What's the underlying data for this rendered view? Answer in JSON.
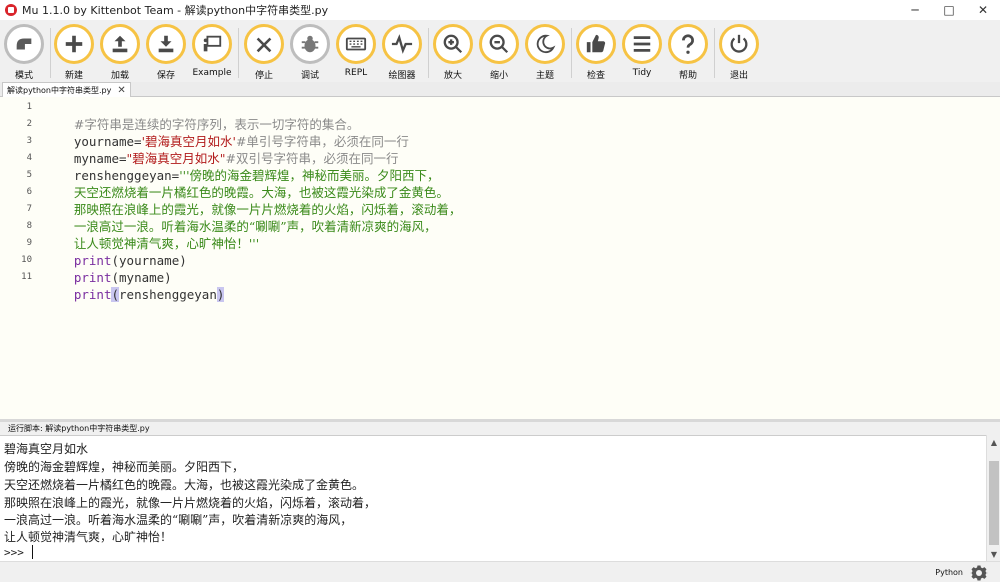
{
  "window": {
    "title": "Mu 1.1.0 by Kittenbot Team - 解读python中字符串类型.py",
    "controls": [
      "─",
      "□",
      "✕"
    ]
  },
  "toolbar": {
    "buttons": [
      {
        "label": "模式",
        "icon": "mode-icon"
      },
      {
        "label": "新建",
        "icon": "plus-icon"
      },
      {
        "label": "加载",
        "icon": "upload-icon"
      },
      {
        "label": "保存",
        "icon": "download-icon"
      },
      {
        "label": "Example",
        "icon": "presentation-icon"
      },
      {
        "label": "停止",
        "icon": "close-icon"
      },
      {
        "label": "调试",
        "icon": "bug-icon"
      },
      {
        "label": "REPL",
        "icon": "keyboard-icon"
      },
      {
        "label": "绘图器",
        "icon": "pulse-icon"
      },
      {
        "label": "放大",
        "icon": "zoom-in-icon"
      },
      {
        "label": "缩小",
        "icon": "zoom-out-icon"
      },
      {
        "label": "主题",
        "icon": "moon-icon"
      },
      {
        "label": "检查",
        "icon": "thumbs-up-icon"
      },
      {
        "label": "Tidy",
        "icon": "menu-lines-icon"
      },
      {
        "label": "帮助",
        "icon": "question-icon"
      },
      {
        "label": "退出",
        "icon": "power-icon"
      }
    ]
  },
  "tab": {
    "label": "解读python中字符串类型.py",
    "close": "✕"
  },
  "editor": {
    "line_numbers": [
      "1",
      "2",
      "3",
      "4",
      "5",
      "6",
      "7",
      "8",
      "9",
      "10",
      "11"
    ],
    "lines": [
      {
        "text": "#字符串是连续的字符序列，表示一切字符的集合。"
      },
      {
        "a": "yourname=",
        "b": "'碧海真空月如水'",
        "c": "#单引号字符串，必须在同一行"
      },
      {
        "a": "myname=",
        "b": "\"碧海真空月如水\"",
        "c": "#双引号字符串，必须在同一行"
      },
      {
        "a": "renshenggeyan=",
        "b": "'''傍晚的海金碧辉煌，神秘而美丽。夕阳西下，"
      },
      {
        "b": "天空还燃烧着一片橘红色的晚霞。大海，也被这霞光染成了金黄色。"
      },
      {
        "b": "那映照在浪峰上的霞光，就像一片片燃烧着的火焰，闪烁着，滚动着，"
      },
      {
        "b": "一浪高过一浪。听着海水温柔的“唰唰”声，吹着清新凉爽的海风，"
      },
      {
        "b": "让人顿觉神清气爽，心旷神怡！'''"
      },
      {
        "kw": "print",
        "p1": "(",
        "id": "yourname",
        "p2": ")"
      },
      {
        "kw": "print",
        "p1": "(",
        "id": "myname",
        "p2": ")"
      },
      {
        "kw": "print",
        "p1": "(",
        "id": "renshenggeyan",
        "p2": ")"
      }
    ]
  },
  "runner": {
    "header": "运行脚本: 解读python中字符串类型.py",
    "output": [
      "碧海真空月如水",
      "傍晚的海金碧辉煌，神秘而美丽。夕阳西下，",
      "天空还燃烧着一片橘红色的晚霞。大海，也被这霞光染成了金黄色。",
      "那映照在浪峰上的霞光，就像一片片燃烧着的火焰，闪烁着，滚动着，",
      "一浪高过一浪。听着海水温柔的“唰唰”声，吹着清新凉爽的海风，",
      "让人顿觉神清气爽，心旷神怡！"
    ],
    "prompt": ">>>"
  },
  "statusbar": {
    "mode": "Python"
  },
  "colors": {
    "accent": "#f6c344",
    "string": "#3a8a1a",
    "comment": "#8a8a8a",
    "keyword": "#7a2ea0"
  }
}
